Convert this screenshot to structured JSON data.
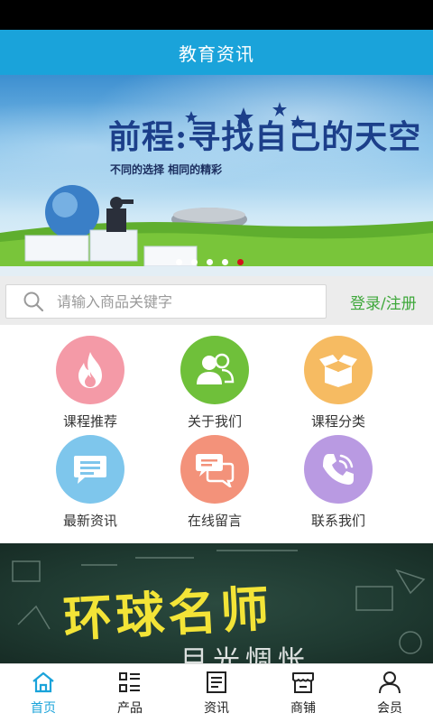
{
  "header": {
    "title": "教育资讯"
  },
  "banner": {
    "headline": "前程:寻找自己的天空",
    "subline": "不同的选择 相同的精彩",
    "slide_count": 5,
    "active_slide": 5
  },
  "search": {
    "placeholder": "请输入商品关键字",
    "login_label": "登录/注册"
  },
  "menu": {
    "items": [
      {
        "label": "课程推荐",
        "icon": "flame-icon",
        "color": "#f49aa7"
      },
      {
        "label": "关于我们",
        "icon": "users-icon",
        "color": "#6fc03a"
      },
      {
        "label": "课程分类",
        "icon": "box-icon",
        "color": "#f6bb62"
      },
      {
        "label": "最新资讯",
        "icon": "message-icon",
        "color": "#7ec6ec"
      },
      {
        "label": "在线留言",
        "icon": "chat-icon",
        "color": "#f3927a"
      },
      {
        "label": "联系我们",
        "icon": "phone-icon",
        "color": "#b99ae2"
      }
    ]
  },
  "promo": {
    "headline": "环球名师",
    "subline": "目光惆怅"
  },
  "tabbar": {
    "items": [
      {
        "label": "首页",
        "icon": "home-icon",
        "active": true
      },
      {
        "label": "产品",
        "icon": "grid-list-icon",
        "active": false
      },
      {
        "label": "资讯",
        "icon": "news-icon",
        "active": false
      },
      {
        "label": "商铺",
        "icon": "shop-icon",
        "active": false
      },
      {
        "label": "会员",
        "icon": "user-icon",
        "active": false
      }
    ],
    "active_color": "#1aa3da"
  }
}
